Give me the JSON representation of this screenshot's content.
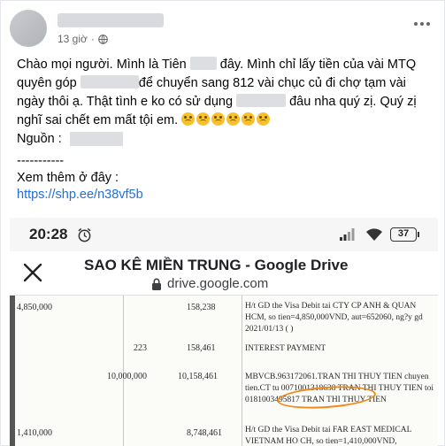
{
  "post": {
    "timestamp": "13 giờ",
    "text_line_1_a": "Chào mọi người. Mình là Tiên",
    "text_line_1_b": "đây. Mình chỉ lấy tiền của vài MTQ",
    "text_line_2_a": "quyên góp",
    "text_line_2_b": "để chuyển sang 812 vài chục củ đi chợ tạm vài",
    "text_line_3_a": "ngày thôi ạ. Thật tình e ko có sử dụng",
    "text_line_3_b": "đâu nha quý zị. Quý zị",
    "text_line_4": "nghĩ sai chết em mất tội em.",
    "source_label": "Nguồn :",
    "separator": "-----------",
    "see_more": "Xem thêm ở đây :",
    "link": "https://shp.ee/n38vf5b"
  },
  "phone": {
    "time": "20:28",
    "battery": "37",
    "title": "SAO KÊ MIỀN TRUNG - Google Drive",
    "url": "drive.google.com"
  },
  "statement": {
    "rows": [
      {
        "amount": "4,850,000",
        "balance": "158,238",
        "desc": "H/t GD the Visa Debit tai CTY CP ANH & QUAN       HCM, so tien=4,850,000VND, aut=652060, ng?y gd 2021/01/13   (     )"
      },
      {
        "amount": "223",
        "balance": "158,461",
        "desc": "INTEREST PAYMENT"
      },
      {
        "amount": "10,000,000",
        "balance": "10,158,461",
        "desc": "MBVCB.963172061.TRAN THI THUY TIEN chuyen tien.CT tu 0071001318638 TRAN THI THUY TIEN toi 0181003495817 TRAN THI THUY TIEN"
      },
      {
        "amount": "1,410,000",
        "balance": "8,748,461",
        "desc": "H/t GD the Visa Debit tai FAR EAST MEDICAL VIETNAM HO CH, so tien=1,410,000VND,"
      }
    ],
    "highlighted_account": "71001318638"
  }
}
